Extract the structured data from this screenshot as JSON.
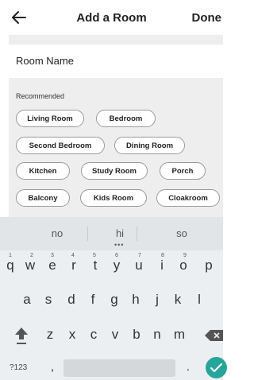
{
  "header": {
    "title": "Add a Room",
    "done_label": "Done",
    "back_icon": "arrow-left-icon"
  },
  "form": {
    "room_name_label": "Room Name"
  },
  "recommended": {
    "label": "Recommended",
    "chips": [
      "Living Room",
      "Bedroom",
      "Second Bedroom",
      "Dining Room",
      "Kitchen",
      "Study Room",
      "Porch",
      "Balcony",
      "Kids Room",
      "Cloakroom"
    ]
  },
  "keyboard": {
    "suggestions": [
      "no",
      "hi",
      "so"
    ],
    "row1": [
      "q",
      "w",
      "e",
      "r",
      "t",
      "y",
      "u",
      "i",
      "o",
      "p"
    ],
    "row1_numbers": [
      "1",
      "2",
      "3",
      "4",
      "5",
      "6",
      "7",
      "8",
      "9"
    ],
    "row2": [
      "a",
      "s",
      "d",
      "f",
      "g",
      "h",
      "j",
      "k",
      "l"
    ],
    "row3": [
      "z",
      "x",
      "c",
      "v",
      "b",
      "n",
      "m"
    ],
    "symbols_label": "?123",
    "comma": ",",
    "period": ".",
    "accent_color": "#26a69a"
  }
}
